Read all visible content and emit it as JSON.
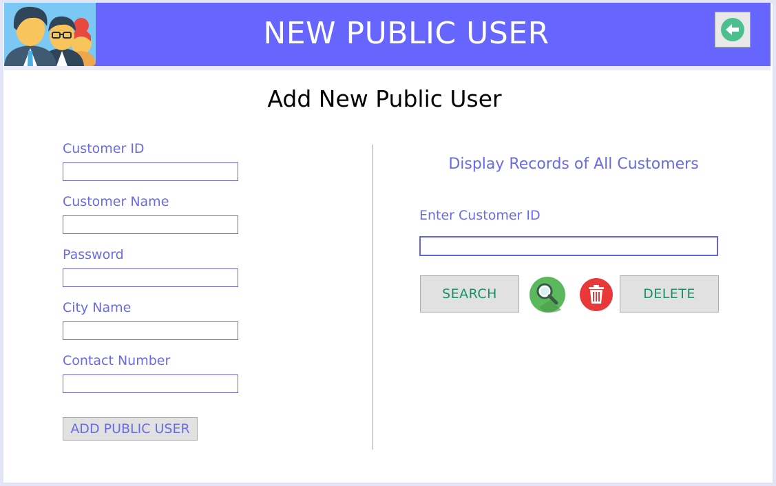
{
  "header": {
    "title": "NEW PUBLIC USER",
    "logo_icon": "group-of-users-icon",
    "back_icon": "arrow-left-circle-icon",
    "color": "#6666ff"
  },
  "page": {
    "title": "Add New Public User"
  },
  "form": {
    "fields": [
      {
        "label": "Customer ID",
        "value": ""
      },
      {
        "label": "Customer Name",
        "value": ""
      },
      {
        "label": "Password",
        "value": ""
      },
      {
        "label": "City Name",
        "value": ""
      },
      {
        "label": "Contact Number",
        "value": ""
      }
    ],
    "add_button_label": "ADD PUBLIC USER"
  },
  "records": {
    "heading": "Display Records of All Customers",
    "customer_id_label": "Enter Customer ID",
    "customer_id_value": "",
    "search_button_label": "SEARCH",
    "search_icon": "magnifier-icon",
    "delete_icon": "trash-icon",
    "delete_button_label": "DELETE"
  },
  "colors": {
    "label": "#6a6ae6",
    "action_text": "#1a9068",
    "search_icon_bg": "#5cb85c",
    "delete_icon_bg": "#e8383a",
    "back_icon": "#4cbf8f"
  }
}
